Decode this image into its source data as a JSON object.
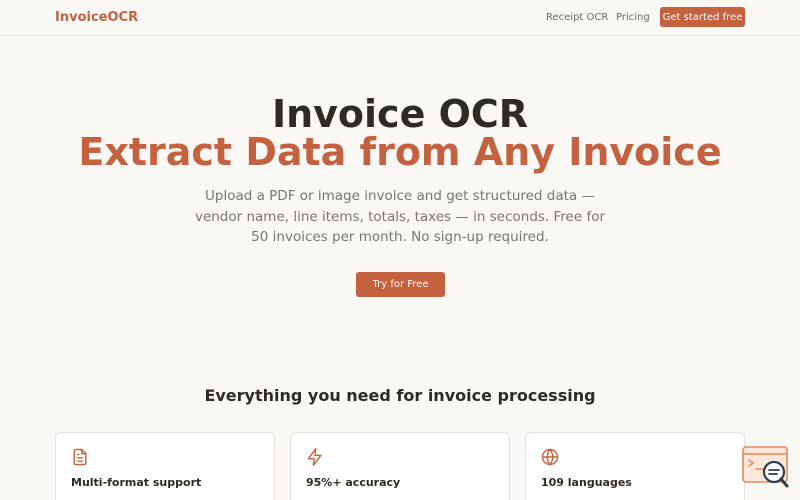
{
  "nav": {
    "brand": "InvoiceOCR",
    "links": [
      "Receipt OCR",
      "Pricing"
    ],
    "cta": "Get started free"
  },
  "hero": {
    "title": "Invoice OCR",
    "subtitle": "Extract Data from Any Invoice",
    "description": "Upload a PDF or image invoice and get structured data — vendor name, line items, totals, taxes — in seconds. Free for 50 invoices per month. No sign-up required.",
    "cta": "Try for Free"
  },
  "features": {
    "heading": "Everything you need for invoice processing",
    "cards": [
      {
        "icon": "document-icon",
        "title": "Multi-format support"
      },
      {
        "icon": "lightning-icon",
        "title": "95%+ accuracy"
      },
      {
        "icon": "globe-icon",
        "title": "109 languages"
      }
    ]
  },
  "colors": {
    "accent": "#c4623f",
    "background": "#faf8f4",
    "text": "#2e2a24",
    "muted": "#7a756e"
  }
}
